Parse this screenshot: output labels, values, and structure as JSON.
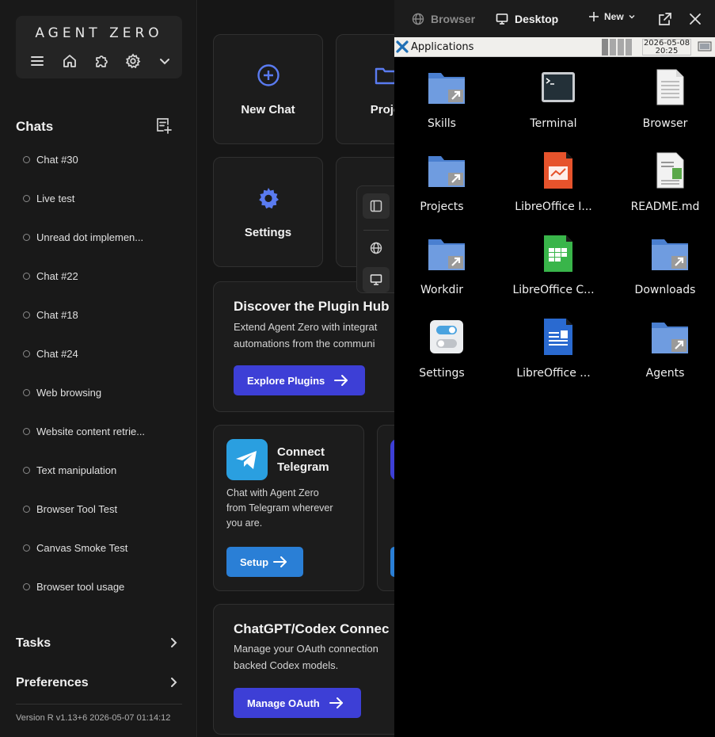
{
  "brand": {
    "logo_text": "AGENT ZERO"
  },
  "sidebar": {
    "chats_title": "Chats",
    "chats": [
      "Chat #30",
      "Live test",
      "Unread dot implemen...",
      "Chat #22",
      "Chat #18",
      "Chat #24",
      "Web browsing",
      "Website content retrie...",
      "Text manipulation",
      "Browser Tool Test",
      "Canvas Smoke Test",
      "Browser tool usage"
    ],
    "tasks_label": "Tasks",
    "preferences_label": "Preferences",
    "version": "Version R v1.13+6 2026-05-07 01:14:12"
  },
  "main": {
    "new_chat_label": "New Chat",
    "projects_label": "Proje",
    "settings_label": "Settings",
    "plugin_hub": {
      "title": "Discover the Plugin Hub",
      "line1": "Extend Agent Zero with integrat",
      "line2": "automations from the communi",
      "button": "Explore Plugins"
    },
    "telegram": {
      "title_line1": "Connect",
      "title_line2": "Telegram",
      "text_line1": "Chat with Agent Zero",
      "text_line2": "from Telegram wherever",
      "text_line3": "you are.",
      "button": "Setup"
    },
    "codex": {
      "title": "ChatGPT/Codex Connec",
      "line1": "Manage your OAuth connection",
      "line2": "backed Codex models.",
      "button": "Manage OAuth"
    }
  },
  "right_panel": {
    "tab_browser": "Browser",
    "tab_desktop": "Desktop",
    "new_label": "New",
    "taskbar": {
      "apps_label": "Applications",
      "date": "2026-05-08",
      "time": "20:25"
    },
    "desktop_icons": [
      {
        "name": "Skills",
        "icon": "folder-link-icon"
      },
      {
        "name": "Terminal",
        "icon": "terminal-icon"
      },
      {
        "name": "Browser",
        "icon": "document-icon"
      },
      {
        "name": "Projects",
        "icon": "folder-link-icon"
      },
      {
        "name": "LibreOffice I...",
        "icon": "impress-icon"
      },
      {
        "name": "README.md",
        "icon": "text-file-icon"
      },
      {
        "name": "Workdir",
        "icon": "folder-link-icon"
      },
      {
        "name": "LibreOffice C...",
        "icon": "calc-icon"
      },
      {
        "name": "Downloads",
        "icon": "folder-link-icon"
      },
      {
        "name": "Settings",
        "icon": "settings-toggle-icon"
      },
      {
        "name": "LibreOffice ...",
        "icon": "writer-icon"
      },
      {
        "name": "Agents",
        "icon": "folder-link-icon"
      }
    ]
  },
  "colors": {
    "accent": "#3d3fd6",
    "telegram": "#2a9fe0",
    "icon_blue": "#5a7bf0"
  }
}
